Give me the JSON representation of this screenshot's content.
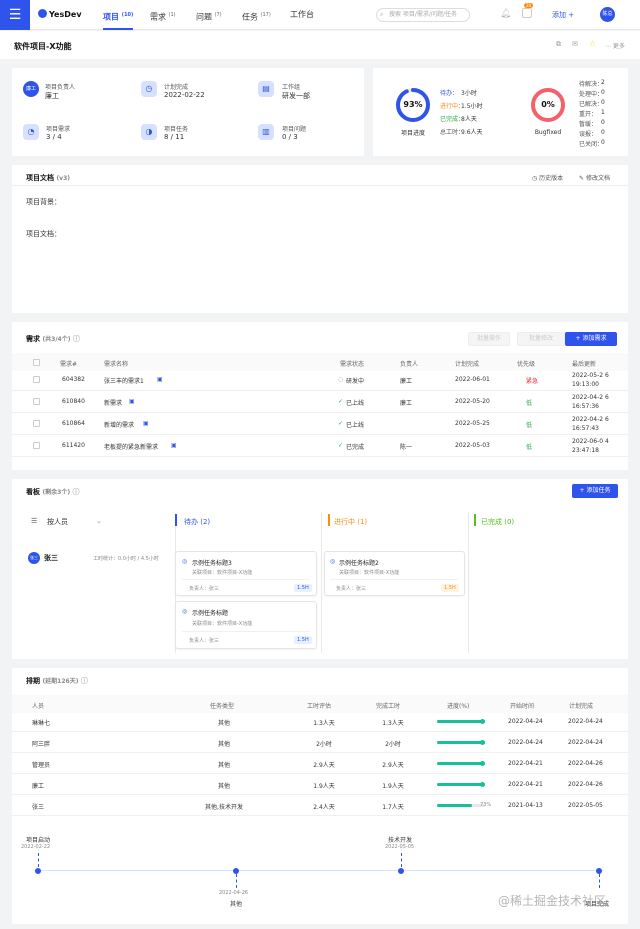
{
  "topbar": {
    "logo": "YesDev",
    "nav": [
      {
        "label": "项目",
        "count": "(10)"
      },
      {
        "label": "需求",
        "count": "(1)"
      },
      {
        "label": "问题",
        "count": "(7)"
      },
      {
        "label": "任务",
        "count": "(17)"
      },
      {
        "label": "工作台",
        "count": ""
      }
    ],
    "search_placeholder": "搜索 项目/需求/问题/任务",
    "add_label": "添加",
    "avatar": "陈总",
    "notify_badge": "20"
  },
  "project": {
    "title": "软件项目-X功能",
    "more_label": "更多",
    "info": [
      {
        "label": "项目负责人",
        "value": "廉工",
        "icon": "person-avatar"
      },
      {
        "label": "计划完成",
        "value": "2022-02-22",
        "icon": "calendar-icon"
      },
      {
        "label": "工作组",
        "value": "研发一部",
        "icon": "group-icon"
      },
      {
        "label": "项目需求",
        "value": "3 / 4",
        "icon": "requirement-icon"
      },
      {
        "label": "项目任务",
        "value": "8 / 11",
        "icon": "task-icon"
      },
      {
        "label": "项目问题",
        "value": "0 / 3",
        "icon": "issue-icon"
      }
    ],
    "progress": {
      "percent": "93%",
      "percent_value": 93,
      "caption": "项目进度",
      "stats": [
        {
          "label": "待办：",
          "value": "3小时"
        },
        {
          "label": "进行中：",
          "value": "1.5小时"
        },
        {
          "label": "已完成：",
          "value": "8人天"
        },
        {
          "label": "总工时：",
          "value": "9.6人天"
        }
      ]
    },
    "bug": {
      "percent": "0%",
      "percent_value": 0,
      "caption": "Bugfixed",
      "stats": [
        {
          "label": "待解决：",
          "value": "2"
        },
        {
          "label": "处理中：",
          "value": "0"
        },
        {
          "label": "已解决：",
          "value": "0"
        },
        {
          "label": "重开：",
          "value": "1"
        },
        {
          "label": "暂缓：",
          "value": "0"
        },
        {
          "label": "误报：",
          "value": "0"
        },
        {
          "label": "已关闭：",
          "value": "0"
        }
      ]
    }
  },
  "docs": {
    "title": "项目文档",
    "version": "(v3)",
    "history_label": "历史版本",
    "edit_label": "修改文档",
    "background_label": "项目背景：",
    "doc_label": "项目文档："
  },
  "requirements": {
    "title": "需求",
    "count": "(共3/4个)",
    "add_label": "+ 添加需求",
    "btn1": "批量操作",
    "btn2": "批量修改",
    "headers": [
      "需求#",
      "需求名称",
      "需求状态",
      "负责人",
      "计划完成",
      "优先级",
      "最后更新"
    ],
    "rows": [
      {
        "id": "604382",
        "name": "张三丰的需求1",
        "status": "研发中",
        "owner": "廉工",
        "plan": "2022-06-01",
        "priority": "紧急",
        "updated": "2022-05-2 6 19:13:00"
      },
      {
        "id": "610840",
        "name": "新需求",
        "status": "已上线",
        "owner": "廉工",
        "plan": "2022-05-20",
        "priority": "低",
        "updated": "2022-04-2 6 16:57:36"
      },
      {
        "id": "610864",
        "name": "新增的需求",
        "status": "已上线",
        "owner": "",
        "plan": "2022-05-25",
        "priority": "低",
        "updated": "2022-04-2 6 16:57:43"
      },
      {
        "id": "611420",
        "name": "老板提的紧急新需求",
        "status": "已完成",
        "owner": "陈一",
        "plan": "2022-05-03",
        "priority": "低",
        "updated": "2022-06-0 4 23:47:18"
      }
    ]
  },
  "board": {
    "title": "看板",
    "count": "(剩余3个)",
    "add_label": "+ 添加任务",
    "group_label": "按人员",
    "columns": [
      {
        "label": "待办 (2)",
        "color": "#2f54eb"
      },
      {
        "label": "进行中 (1)",
        "color": "#fa8c16"
      },
      {
        "label": "已完成 (0)",
        "color": "#52c41a"
      }
    ],
    "person": {
      "name": "张三",
      "avatar": "张三",
      "stats": "工时统计：0.0小时 / 4.5小时"
    },
    "cards": [
      {
        "title": "示例任务标题3",
        "project": "关联项目：软件项目-X功能",
        "owner": "负责人：张三",
        "hours": "1.5H"
      },
      {
        "title": "示例任务标题",
        "project": "关联项目：软件项目-X功能",
        "owner": "负责人：张三",
        "hours": "1.5H"
      },
      {
        "title": "示例任务标题2",
        "project": "关联项目：软件项目-X功能",
        "owner": "负责人：张三",
        "hours": "1.5H"
      }
    ]
  },
  "schedule": {
    "title": "排期",
    "count": "(延期126天)",
    "headers": [
      "人员",
      "任务类型",
      "工时评估",
      "完成工时",
      "进度(%)",
      "开始时间",
      "计划完成"
    ],
    "rows": [
      {
        "person": "琳琳七",
        "type": "其他",
        "est": "1.3人天",
        "done": "1.3人天",
        "progress": 100,
        "progress_label": "",
        "start": "2022-04-24",
        "end": "2022-04-24"
      },
      {
        "person": "阿三胖",
        "type": "其他",
        "est": "2小时",
        "done": "2小时",
        "progress": 100,
        "progress_label": "",
        "start": "2022-04-24",
        "end": "2022-04-24"
      },
      {
        "person": "管理员",
        "type": "其他",
        "est": "2.9人天",
        "done": "2.9人天",
        "progress": 100,
        "progress_label": "",
        "start": "2022-04-21",
        "end": "2022-04-26"
      },
      {
        "person": "廉工",
        "type": "其他",
        "est": "1.9人天",
        "done": "1.9人天",
        "progress": 100,
        "progress_label": "",
        "start": "2022-04-21",
        "end": "2022-04-26"
      },
      {
        "person": "张三",
        "type": "其他,技术开发",
        "est": "2.4人天",
        "done": "1.7人天",
        "progress": 73,
        "progress_label": "73%",
        "start": "2021-04-13",
        "end": "2022-05-05"
      }
    ],
    "timeline": [
      {
        "label": "项目启动",
        "date": "2022-02-22"
      },
      {
        "label": "其他",
        "date": "2022-04-26"
      },
      {
        "label": "技术开发",
        "date": "2022-05-05"
      },
      {
        "label": "项目完成",
        "date": ""
      }
    ]
  },
  "watermark": "@稀土掘金技术社区"
}
